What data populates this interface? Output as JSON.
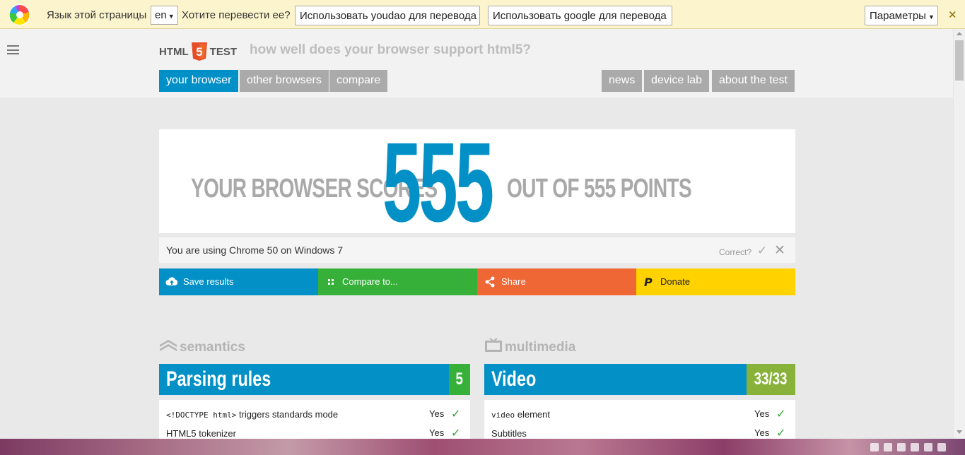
{
  "translate_bar": {
    "page_language_label": "Язык этой страницы",
    "language_value": "en",
    "translate_question": "Хотите перевести ее?",
    "youdao_button": "Использовать youdao для перевода",
    "google_button": "Использовать google для перевода",
    "options_button": "Параметры",
    "close_glyph": "✕"
  },
  "header": {
    "brand_left": "HTML",
    "brand_badge": "5",
    "brand_right": "TEST",
    "tagline": "how well does your browser support html5?",
    "nav_left": [
      "your browser",
      "other browsers",
      "compare"
    ],
    "nav_right": [
      "news",
      "device lab",
      "about the test"
    ]
  },
  "score": {
    "lead": "YOUR BROWSER SCORES",
    "value": "555",
    "trail": "OUT OF 555 POINTS"
  },
  "browser_info": {
    "message": "You are using Chrome 50 on Windows 7",
    "correct_label": "Correct?",
    "check_glyph": "✓",
    "close_glyph": "✕"
  },
  "actions": [
    {
      "label": "Save results",
      "icon": "cloud-upload-icon",
      "color": "#0290c6"
    },
    {
      "label": "Compare to...",
      "icon": "grid-icon",
      "color": "#37b03a"
    },
    {
      "label": "Share",
      "icon": "share-icon",
      "color": "#ee6735"
    },
    {
      "label": "Donate",
      "icon": "paypal-icon",
      "color": "#ffd200"
    }
  ],
  "sections": {
    "left": {
      "title": "semantics",
      "category": "Parsing rules",
      "count": "5",
      "rows": [
        {
          "code": "<!DOCTYPE html>",
          "label": " triggers standards mode",
          "answer": "Yes"
        },
        {
          "code": "",
          "label": "HTML5 tokenizer",
          "answer": "Yes"
        }
      ]
    },
    "right": {
      "title": "multimedia",
      "category": "Video",
      "count": "33/33",
      "rows": [
        {
          "code": "video",
          "label": " element",
          "answer": "Yes"
        },
        {
          "code": "",
          "label": "Subtitles",
          "answer": "Yes"
        }
      ]
    }
  },
  "colors": {
    "accent_blue": "#0290c6",
    "count_green": "#37b03a",
    "count_olive": "#88b23a",
    "tick_green": "#37a43a"
  }
}
